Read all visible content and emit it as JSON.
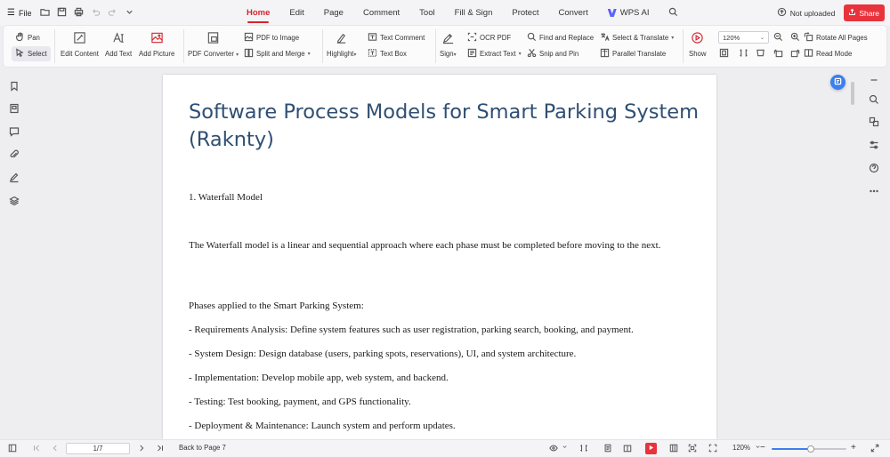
{
  "menubar": {
    "file_label": "File",
    "tabs": [
      "Home",
      "Edit",
      "Page",
      "Comment",
      "Tool",
      "Fill & Sign",
      "Protect",
      "Convert",
      "WPS AI"
    ],
    "active_tab": "Home",
    "upload_status": "Not uploaded",
    "share_label": "Share"
  },
  "ribbon": {
    "pan": "Pan",
    "select": "Select",
    "edit_content": "Edit Content",
    "add_text": "Add Text",
    "add_picture": "Add Picture",
    "pdf_converter": "PDF Converter",
    "pdf_to_image": "PDF to Image",
    "split_merge": "Split and Merge",
    "highlight": "Highlight",
    "text_comment": "Text Comment",
    "text_box": "Text Box",
    "sign": "Sign",
    "ocr_pdf": "OCR PDF",
    "extract_text": "Extract Text",
    "find_replace": "Find and Replace",
    "snip_pin": "Snip and Pin",
    "select_translate": "Select & Translate",
    "parallel_translate": "Parallel Translate",
    "show": "Show",
    "zoom": "120%",
    "rotate_all": "Rotate All Pages",
    "read_mode": "Read Mode"
  },
  "document": {
    "title": "Software Process Models for Smart Parking System (Raknty)",
    "section": "1. Waterfall Model",
    "paragraph": "The Waterfall model is a linear and sequential approach where each phase must be completed before moving to the next.",
    "phases_heading": "Phases applied to the Smart Parking System:",
    "phases": [
      "- Requirements Analysis: Define system features such as user registration, parking search, booking, and payment.",
      "- System Design: Design database (users, parking spots, reservations), UI, and system architecture.",
      "- Implementation: Develop mobile app, web system, and backend.",
      "- Testing: Test booking, payment, and GPS functionality.",
      "- Deployment & Maintenance: Launch system and perform updates."
    ]
  },
  "statusbar": {
    "page_indicator": "1/7",
    "back_to_page": "Back to Page 7",
    "zoom": "120%",
    "zoom_fraction": 0.52
  }
}
